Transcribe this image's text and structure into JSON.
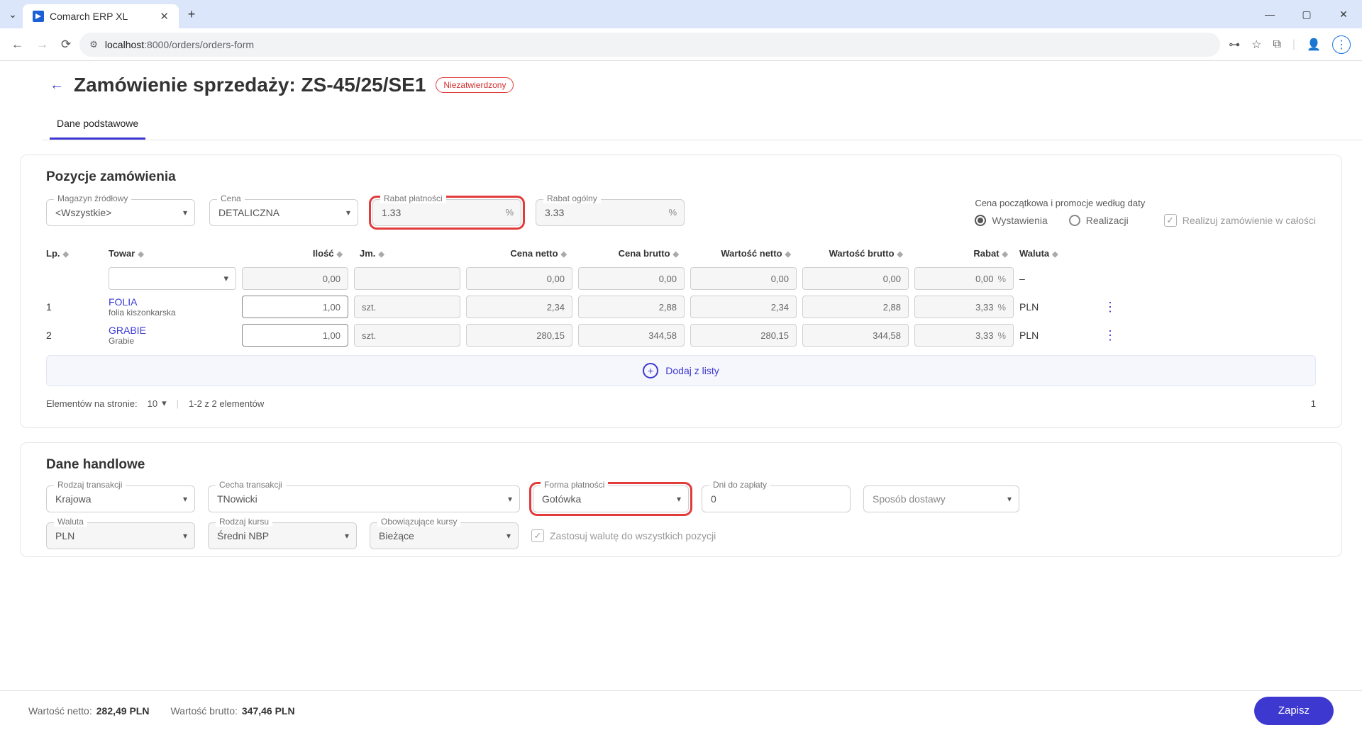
{
  "browser": {
    "tab_title": "Comarch ERP XL",
    "url_host": "localhost",
    "url_port": ":8000",
    "url_path": "/orders/orders-form"
  },
  "page": {
    "title": "Zamówienie sprzedaży: ZS-45/25/SE1",
    "status_badge": "Niezatwierdzony",
    "tab_basic": "Dane podstawowe"
  },
  "order_items": {
    "section_title": "Pozycje zamówienia",
    "fields": {
      "warehouse_label": "Magazyn źródłowy",
      "warehouse_value": "<Wszystkie>",
      "price_label": "Cena",
      "price_value": "DETALICZNA",
      "rabat_platnosci_label": "Rabat płatności",
      "rabat_platnosci_value": "1.33",
      "rabat_platnosci_suffix": "%",
      "rabat_ogolny_label": "Rabat ogólny",
      "rabat_ogolny_value": "3.33",
      "rabat_ogolny_suffix": "%"
    },
    "right_panel": {
      "label": "Cena początkowa i promocje według daty",
      "radio_issuance": "Wystawienia",
      "radio_realization": "Realizacji",
      "checkbox_full": "Realizuj zamówienie w całości"
    },
    "headers": {
      "lp": "Lp.",
      "towar": "Towar",
      "ilosc": "Ilość",
      "jm": "Jm.",
      "cena_netto": "Cena netto",
      "cena_brutto": "Cena brutto",
      "wartosc_netto": "Wartość netto",
      "wartosc_brutto": "Wartość brutto",
      "rabat": "Rabat",
      "waluta": "Waluta"
    },
    "blank_row": {
      "ilosc": "0,00",
      "cena_netto": "0,00",
      "cena_brutto": "0,00",
      "wartosc_netto": "0,00",
      "wartosc_brutto": "0,00",
      "rabat": "0,00",
      "rabat_suffix": "%",
      "waluta": "–"
    },
    "rows": [
      {
        "lp": "1",
        "code": "FOLIA",
        "desc": "folia kiszonkarska",
        "ilosc": "1,00",
        "jm": "szt.",
        "cena_netto": "2,34",
        "cena_brutto": "2,88",
        "wartosc_netto": "2,34",
        "wartosc_brutto": "2,88",
        "rabat": "3,33",
        "rabat_suffix": "%",
        "waluta": "PLN"
      },
      {
        "lp": "2",
        "code": "GRABIE",
        "desc": "Grabie",
        "ilosc": "1,00",
        "jm": "szt.",
        "cena_netto": "280,15",
        "cena_brutto": "344,58",
        "wartosc_netto": "280,15",
        "wartosc_brutto": "344,58",
        "rabat": "3,33",
        "rabat_suffix": "%",
        "waluta": "PLN"
      }
    ],
    "add_from_list": "Dodaj z listy",
    "pager": {
      "per_page_label": "Elementów na stronie:",
      "per_page_value": "10",
      "range_text": "1-2 z 2 elementów",
      "page_current": "1"
    }
  },
  "trade_data": {
    "section_title": "Dane handlowe",
    "rodzaj_transakcji_label": "Rodzaj transakcji",
    "rodzaj_transakcji_value": "Krajowa",
    "cecha_transakcji_label": "Cecha transakcji",
    "cecha_transakcji_value": "TNowicki",
    "forma_platnosci_label": "Forma płatności",
    "forma_platnosci_value": "Gotówka",
    "dni_do_zaplaty_label": "Dni do zapłaty",
    "dni_do_zaplaty_value": "0",
    "sposob_dostawy_label": "Sposób dostawy",
    "sposob_dostawy_value": "",
    "waluta_label": "Waluta",
    "waluta_value": "PLN",
    "rodzaj_kursu_label": "Rodzaj kursu",
    "rodzaj_kursu_value": "Średni NBP",
    "obow_kursy_label": "Obowiązujące kursy",
    "obow_kursy_value": "Bieżące",
    "apply_currency_checkbox": "Zastosuj walutę do wszystkich pozycji"
  },
  "footer": {
    "netto_label": "Wartość netto:",
    "netto_value": "282,49 PLN",
    "brutto_label": "Wartość brutto:",
    "brutto_value": "347,46 PLN",
    "save_button": "Zapisz"
  }
}
